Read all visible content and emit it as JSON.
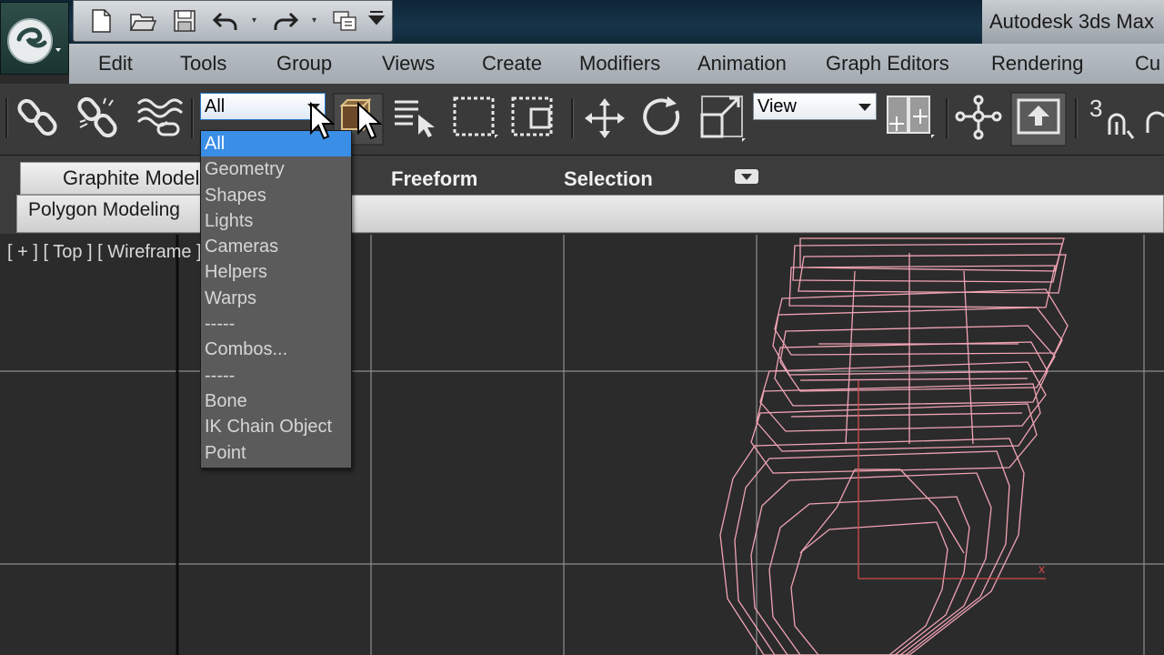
{
  "app": {
    "title": "Autodesk 3ds Max"
  },
  "menu": {
    "items": [
      "Edit",
      "Tools",
      "Group",
      "Views",
      "Create",
      "Modifiers",
      "Animation",
      "Graph Editors",
      "Rendering",
      "Cu"
    ]
  },
  "toolbar": {
    "selection_filter": {
      "value": "All",
      "options": [
        "All",
        "Geometry",
        "Shapes",
        "Lights",
        "Cameras",
        "Helpers",
        "Warps",
        "-----",
        "Combos...",
        "-----",
        "Bone",
        "IK Chain Object",
        "Point"
      ],
      "selected_index": 0
    },
    "coordinate_system": {
      "value": "View"
    },
    "snap_label": "3"
  },
  "ribbon": {
    "tabs": [
      "Graphite Modeling Tools",
      "Freeform",
      "Selection"
    ],
    "panel_label": "Polygon Modeling"
  },
  "viewport": {
    "label": "[ + ] [ Top ] [ Wireframe ]"
  },
  "colors": {
    "wireframe": "#f0a3b4",
    "grid": "#8d8d8d",
    "selection_highlight": "#3a8ee6"
  }
}
